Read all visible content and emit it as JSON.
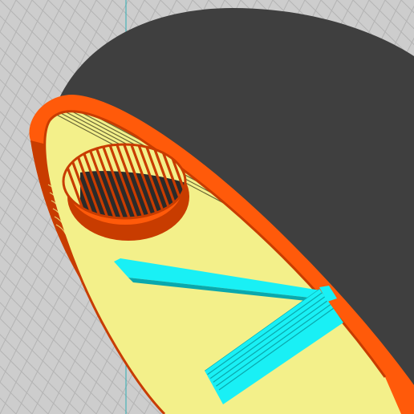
{
  "viewport": {
    "view": "gcode-layer-preview",
    "colors": {
      "background": "#cdcdcd",
      "bed_grid": "#b4b4b4",
      "shell_shadow": "#3f3f3f",
      "perimeter": "#ff5a0a",
      "perimeter_dark": "#c83c00",
      "infill": "#f3f08a",
      "infill_line": "#3c3a1a",
      "support": "#19f0f5",
      "support_dark": "#0aa8ad",
      "axis_line": "#2fb0b5"
    },
    "features": [
      {
        "name": "external-perimeter",
        "color": "#ff5a0a"
      },
      {
        "name": "solid-infill",
        "color": "#f3f08a"
      },
      {
        "name": "support-material",
        "color": "#19f0f5"
      },
      {
        "name": "dark-shell",
        "color": "#3f3f3f"
      }
    ]
  }
}
